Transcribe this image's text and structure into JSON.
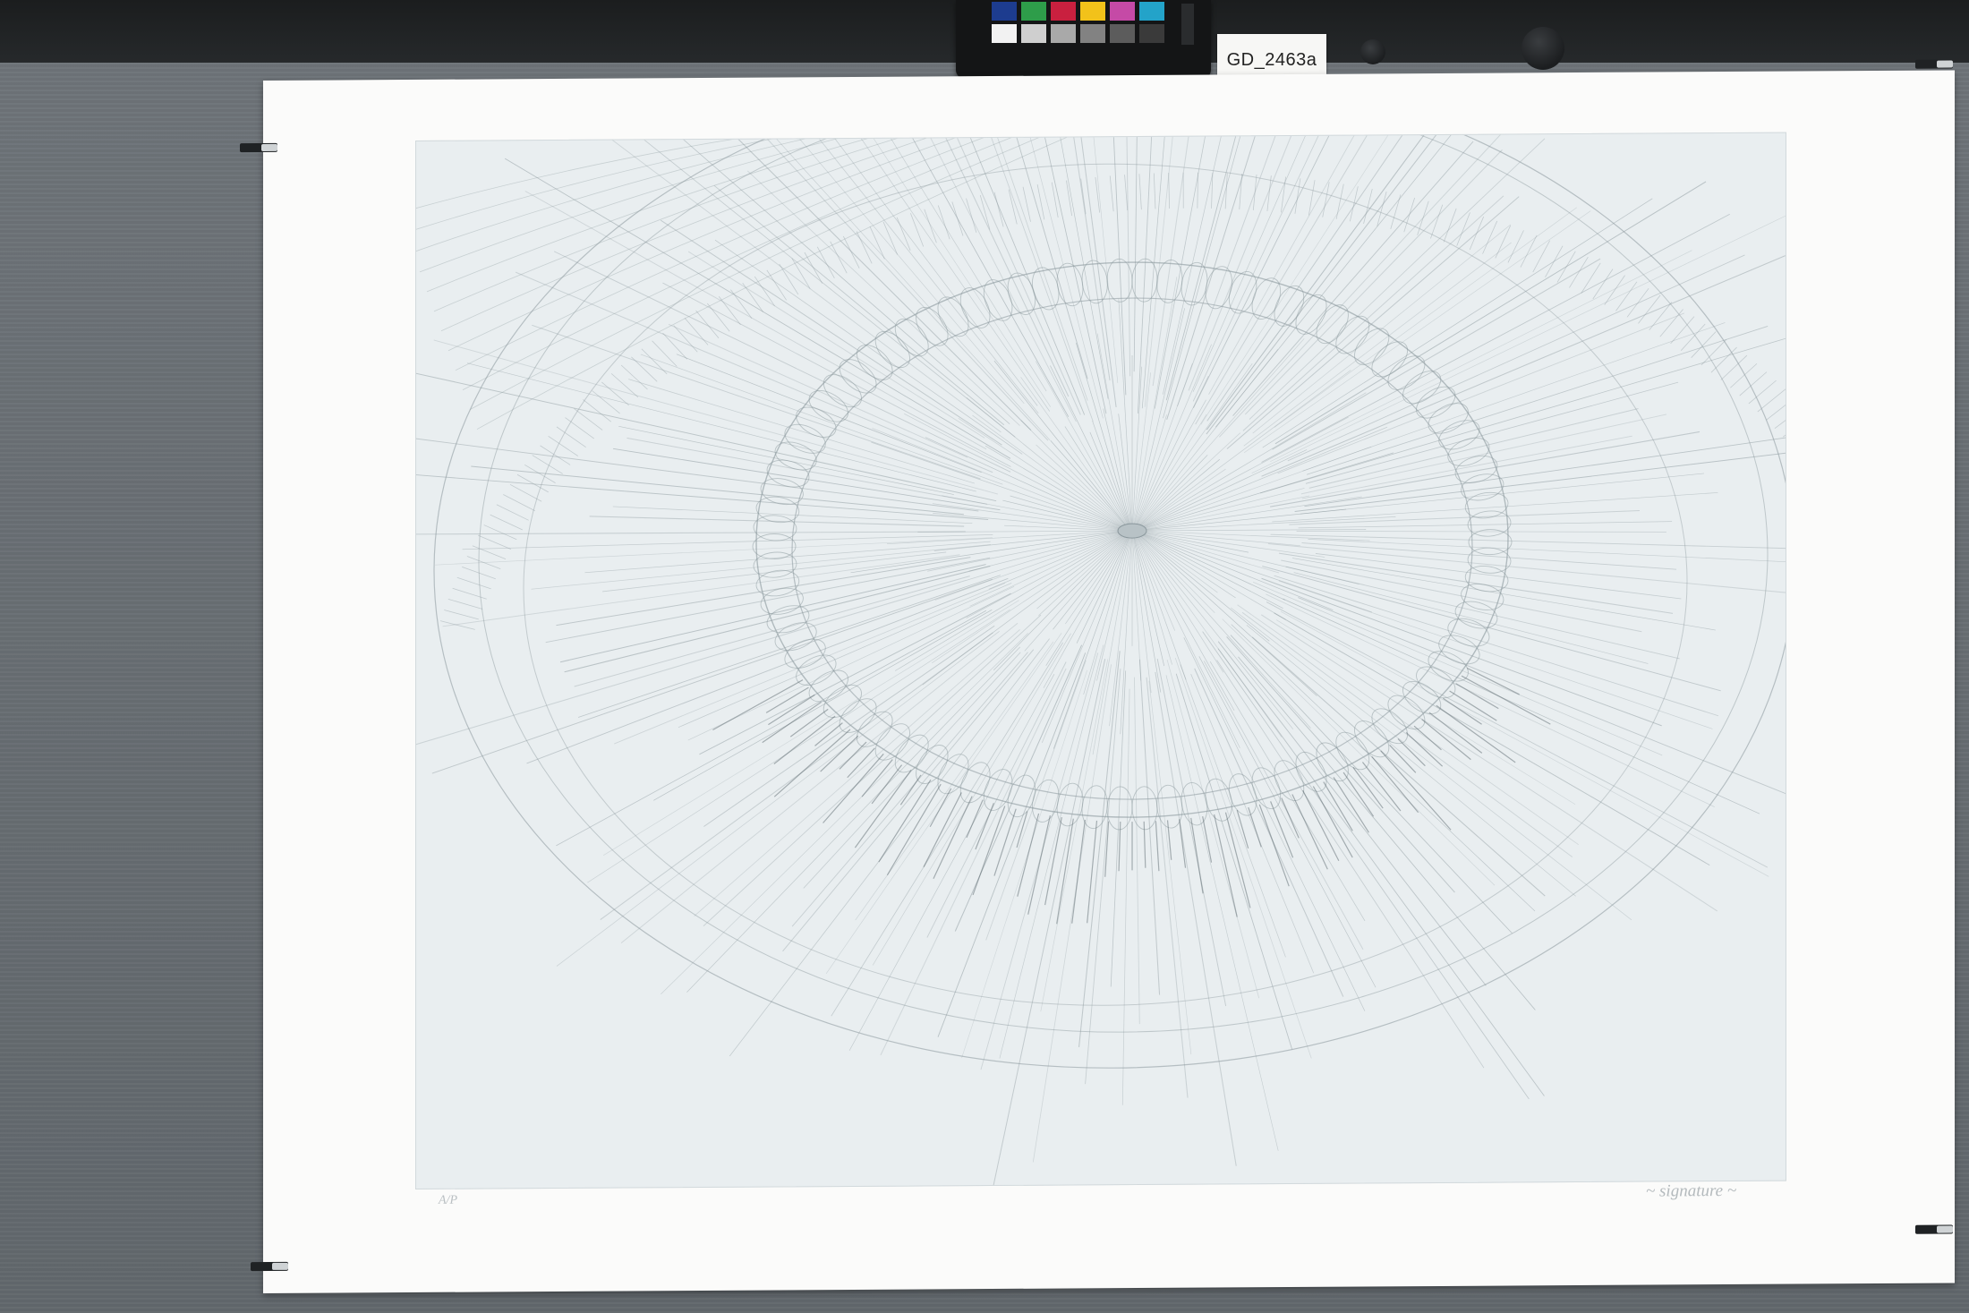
{
  "scene": {
    "label_text": "GD_2463a",
    "checker_row_1": [
      "#1d3c8f",
      "#2e9d4a",
      "#c9203f",
      "#f2c21a",
      "#c54aa6",
      "#23a3c9"
    ],
    "checker_row_2": [
      "#f2f2f2",
      "#cfcfcf",
      "#a9a9a9",
      "#828282",
      "#5c5c5c",
      "#3a3a3a"
    ],
    "paper_color": "#fbfbfa",
    "plate_tone": "#e9eef0",
    "line_color": "#8a979c"
  }
}
